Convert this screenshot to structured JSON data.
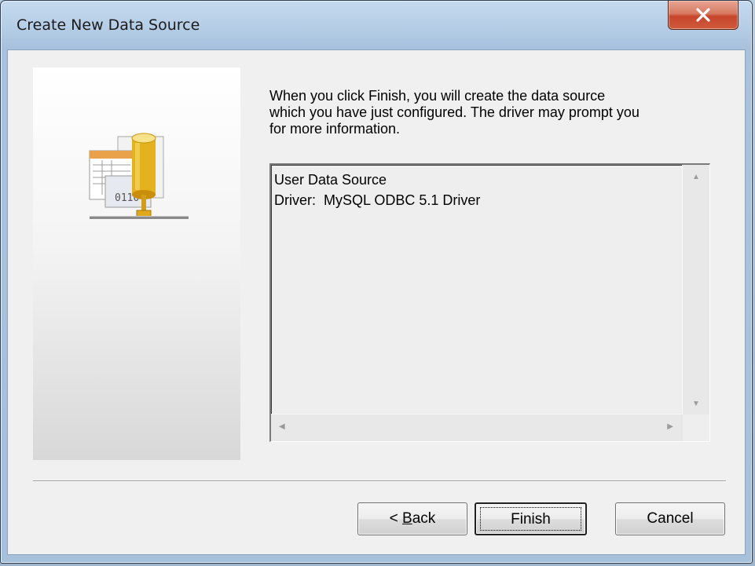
{
  "window": {
    "title": "Create New Data Source",
    "close_icon": "close-icon"
  },
  "description": {
    "line1": "When you click Finish, you will create the data source",
    "line2": "which you have just configured.  The driver may prompt you",
    "line3": "for more information."
  },
  "summary": {
    "line1": "User Data Source",
    "line2": "Driver:  MySQL ODBC 5.1 Driver"
  },
  "buttons": {
    "back_prefix": "< ",
    "back_mnemonic": "B",
    "back_rest": "ack",
    "finish": "Finish",
    "cancel": "Cancel"
  },
  "icons": {
    "side": "database-network-icon"
  }
}
